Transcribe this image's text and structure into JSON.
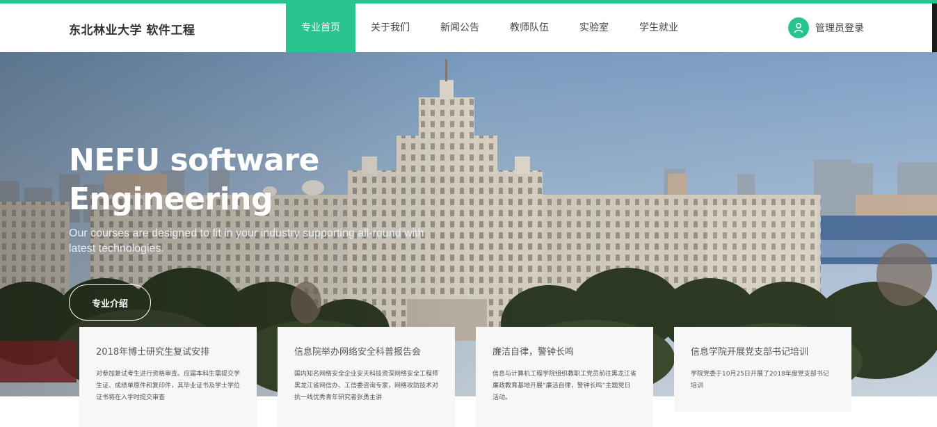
{
  "header": {
    "brand": "东北林业大学 软件工程",
    "nav": [
      {
        "label": "专业首页",
        "active": true
      },
      {
        "label": "关于我们",
        "active": false
      },
      {
        "label": "新闻公告",
        "active": false
      },
      {
        "label": "教师队伍",
        "active": false
      },
      {
        "label": "实验室",
        "active": false
      },
      {
        "label": "学生就业",
        "active": false
      }
    ],
    "login_label": "管理员登录"
  },
  "hero": {
    "title_line1": "NEFU software",
    "title_line2": "Engineering",
    "description": "Our courses are designed to fit in your industry supporting all-round with latest technologies.",
    "button_label": "专业介绍"
  },
  "cards": [
    {
      "title": "2018年博士研究生复试安排",
      "text": "对参加复试考生进行资格审查。应届本科生需提交学生证、成绩单原件和复印件，其毕业证书及学士学位证书将在入学时提交审查"
    },
    {
      "title": "信息院举办网络安全科普报告会",
      "text": "国内知名网络安全企业安天科技资深网络安全工程师黑龙江省网信办、工信委咨询专家，网络攻防技术对抗一线优秀青年研究者张勇主讲"
    },
    {
      "title": "廉洁自律，警钟长鸣",
      "text": "信息与计算机工程学院组织教职工党员前往黑龙江省廉政教育基地开展“廉洁自律，警钟长鸣”主题党日活动。"
    },
    {
      "title": "信息学院开展党支部书记培训",
      "text": "学院党委于10月25日开展了2018年度党支部书记培训"
    }
  ],
  "colors": {
    "accent": "#28c48e",
    "sky": "#8fb0cf",
    "building": "#d8d1c4",
    "trees": "#2f3b26"
  },
  "icons": {
    "login": "user-icon"
  }
}
